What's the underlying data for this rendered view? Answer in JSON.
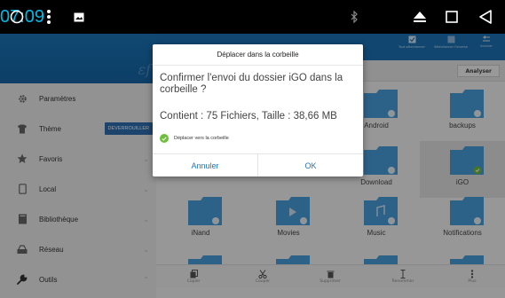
{
  "status_bar": {
    "time": "07:09",
    "icons": [
      "circle-icon",
      "more-vert-icon",
      "gallery-icon",
      "bluetooth-icon",
      "eject-icon",
      "square-icon",
      "back-icon"
    ]
  },
  "toolbar": {
    "select_all_label": "Tout sélectionner",
    "inverse_label": "Sélectionner l'inverse",
    "cancel_label": "Annuler"
  },
  "analyse_label": "Analyser",
  "sidebar": {
    "items": [
      {
        "label": "Paramètres",
        "icon": "gear-icon"
      },
      {
        "label": "Thème",
        "icon": "shirt-icon",
        "badge": "DEVERROUILLER"
      },
      {
        "label": "Favoris",
        "icon": "star-icon"
      },
      {
        "label": "Local",
        "icon": "phone-icon"
      },
      {
        "label": "Bibliothèque",
        "icon": "library-icon"
      },
      {
        "label": "Réseau",
        "icon": "network-icon"
      },
      {
        "label": "Outils",
        "icon": "wrench-icon"
      }
    ]
  },
  "files": {
    "row1": [
      {
        "name": "Android"
      },
      {
        "name": "backups"
      }
    ],
    "row2": [
      {
        "name": "Download"
      },
      {
        "name": "iGO"
      }
    ],
    "row3": [
      {
        "name": "iNand"
      },
      {
        "name": "Movies"
      },
      {
        "name": "Music"
      },
      {
        "name": "Notifications"
      }
    ]
  },
  "bottom_bar": [
    {
      "label": "Copier",
      "icon": "copy-icon"
    },
    {
      "label": "Couper",
      "icon": "scissors-icon"
    },
    {
      "label": "Supprimer",
      "icon": "trash-icon"
    },
    {
      "label": "Renommer",
      "icon": "text-cursor-icon"
    },
    {
      "label": "Plus",
      "icon": "more-vert-icon"
    }
  ],
  "dialog": {
    "title": "Déplacer dans la corbeille",
    "message": "Confirmer l'envoi du dossier iGO dans la corbeille ?",
    "info": "Contient : 75 Fichiers, Taille : 38,66 MB",
    "checkbox_label": "Déplacer vers la corbeille",
    "checkbox_checked": true,
    "cancel_label": "Annuler",
    "ok_label": "OK"
  },
  "colors": {
    "accent": "#1a72b5",
    "folder": "#4a9fdc",
    "time": "#00b8e6",
    "check": "#6cbf3a"
  }
}
